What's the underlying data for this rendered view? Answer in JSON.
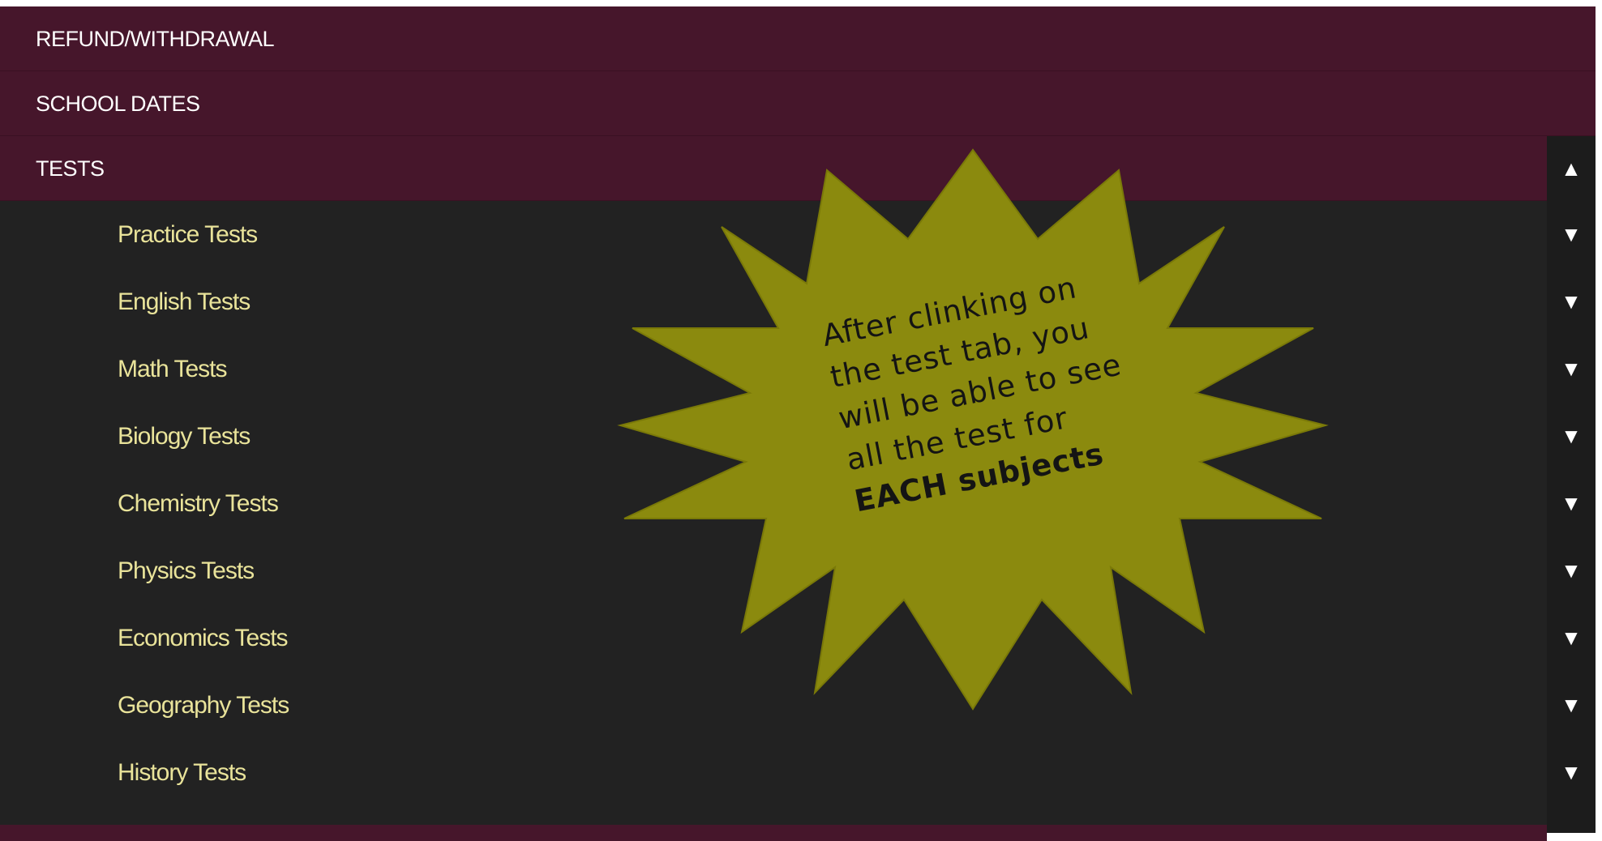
{
  "menu": {
    "top_items": [
      {
        "label": "REFUND/WITHDRAWAL"
      },
      {
        "label": "SCHOOL DATES"
      },
      {
        "label": "TESTS",
        "toggle_icon": "▲"
      }
    ],
    "tests_subitems": [
      {
        "label": "Practice Tests",
        "toggle_icon": "▼"
      },
      {
        "label": "English Tests",
        "toggle_icon": "▼"
      },
      {
        "label": "Math Tests",
        "toggle_icon": "▼"
      },
      {
        "label": "Biology Tests",
        "toggle_icon": "▼"
      },
      {
        "label": "Chemistry Tests",
        "toggle_icon": "▼"
      },
      {
        "label": "Physics Tests",
        "toggle_icon": "▼"
      },
      {
        "label": "Economics Tests",
        "toggle_icon": "▼"
      },
      {
        "label": "Geography Tests",
        "toggle_icon": "▼"
      },
      {
        "label": "History Tests",
        "toggle_icon": "▼"
      }
    ]
  },
  "callout": {
    "line1": "After clinking on",
    "line2": "the test tab, you",
    "line3": "will be able to see",
    "line4": "all the test for",
    "bold_line": "EACH subjects",
    "fill_color": "#8b8a0e"
  },
  "colors": {
    "top_item_bg": "#46162b",
    "submenu_bg": "#222222",
    "submenu_text": "#e9e39a"
  }
}
